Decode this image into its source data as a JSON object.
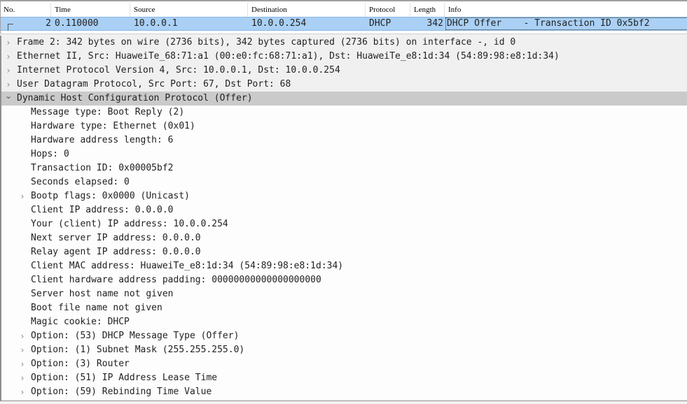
{
  "packet_list": {
    "columns": [
      "No.",
      "Time",
      "Source",
      "Destination",
      "Protocol",
      "Length",
      "Info"
    ],
    "rows": [
      {
        "no": "2",
        "time": "0.110000",
        "source": "10.0.0.1",
        "destination": "10.0.0.254",
        "protocol": "DHCP",
        "length": "342",
        "info": "DHCP Offer    - Transaction ID 0x5bf2"
      }
    ],
    "selected_row_color": "#aad0f5"
  },
  "detail_tree": {
    "items": [
      {
        "level": 0,
        "expander": "collapsed",
        "text": "Frame 2: 342 bytes on wire (2736 bits), 342 bytes captured (2736 bits) on interface -, id 0"
      },
      {
        "level": 0,
        "expander": "collapsed",
        "text": "Ethernet II, Src: HuaweiTe_68:71:a1 (00:e0:fc:68:71:a1), Dst: HuaweiTe_e8:1d:34 (54:89:98:e8:1d:34)"
      },
      {
        "level": 0,
        "expander": "collapsed",
        "text": "Internet Protocol Version 4, Src: 10.0.0.1, Dst: 10.0.0.254"
      },
      {
        "level": 0,
        "expander": "collapsed",
        "text": "User Datagram Protocol, Src Port: 67, Dst Port: 68"
      },
      {
        "level": 0,
        "expander": "expanded",
        "selected": true,
        "text": "Dynamic Host Configuration Protocol (Offer)"
      },
      {
        "level": 1,
        "expander": "none",
        "text": "Message type: Boot Reply (2)"
      },
      {
        "level": 1,
        "expander": "none",
        "text": "Hardware type: Ethernet (0x01)"
      },
      {
        "level": 1,
        "expander": "none",
        "text": "Hardware address length: 6"
      },
      {
        "level": 1,
        "expander": "none",
        "text": "Hops: 0"
      },
      {
        "level": 1,
        "expander": "none",
        "text": "Transaction ID: 0x00005bf2"
      },
      {
        "level": 1,
        "expander": "none",
        "text": "Seconds elapsed: 0"
      },
      {
        "level": 1,
        "expander": "collapsed",
        "text": "Bootp flags: 0x0000 (Unicast)"
      },
      {
        "level": 1,
        "expander": "none",
        "text": "Client IP address: 0.0.0.0"
      },
      {
        "level": 1,
        "expander": "none",
        "text": "Your (client) IP address: 10.0.0.254"
      },
      {
        "level": 1,
        "expander": "none",
        "text": "Next server IP address: 0.0.0.0"
      },
      {
        "level": 1,
        "expander": "none",
        "text": "Relay agent IP address: 0.0.0.0"
      },
      {
        "level": 1,
        "expander": "none",
        "text": "Client MAC address: HuaweiTe_e8:1d:34 (54:89:98:e8:1d:34)"
      },
      {
        "level": 1,
        "expander": "none",
        "text": "Client hardware address padding: 00000000000000000000"
      },
      {
        "level": 1,
        "expander": "none",
        "text": "Server host name not given"
      },
      {
        "level": 1,
        "expander": "none",
        "text": "Boot file name not given"
      },
      {
        "level": 1,
        "expander": "none",
        "text": "Magic cookie: DHCP"
      },
      {
        "level": 1,
        "expander": "collapsed",
        "text": "Option: (53) DHCP Message Type (Offer)"
      },
      {
        "level": 1,
        "expander": "collapsed",
        "text": "Option: (1) Subnet Mask (255.255.255.0)"
      },
      {
        "level": 1,
        "expander": "collapsed",
        "text": "Option: (3) Router"
      },
      {
        "level": 1,
        "expander": "collapsed",
        "text": "Option: (51) IP Address Lease Time"
      },
      {
        "level": 1,
        "expander": "collapsed",
        "text": "Option: (59) Rebinding Time Value"
      }
    ],
    "icons": {
      "collapsed": "chevron-right-icon",
      "expanded": "chevron-down-icon"
    }
  }
}
